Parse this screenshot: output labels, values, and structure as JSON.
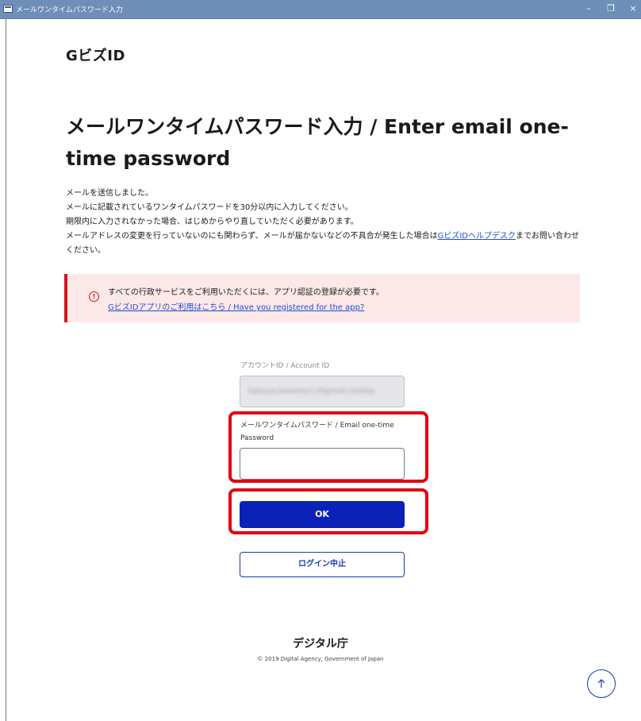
{
  "window": {
    "title": "メールワンタイムパスワード入力",
    "minimize_glyph": "–",
    "restore_glyph": "❐",
    "close_glyph": "×"
  },
  "brand": "GビズID",
  "heading": "メールワンタイムパスワード入力 / Enter email one-time password",
  "intro": {
    "line1": "メールを送信しました。",
    "line2": "メールに記載されているワンタイムパスワードを30分以内に入力してください。",
    "line3": "期限内に入力されなかった場合、はじめからやり直していただく必要があります。",
    "line4_before": "メールアドレスの変更を行っていないのにも関わらず、メールが届かないなどの不具合が発生した場合は",
    "line4_link": "GビズIDヘルプデスク",
    "line4_after": "までお問い合わせください。"
  },
  "alert": {
    "message": "すべての行政サービスをご利用いただくには、アプリ認証の登録が必要です。",
    "link": "GビズIDアプリのご利用はこちら / Have you registered for the app?",
    "icon": "info-circle-icon",
    "color": "#d9101e"
  },
  "form": {
    "account_label": "アカウントID / Account ID",
    "account_value": "katsuya.kanamori.ctf@mail.toshiba",
    "otp_label": "メールワンタイムパスワード / Email one-time Password",
    "otp_value": "",
    "ok_label": "OK",
    "cancel_label": "ログイン中止"
  },
  "footer": {
    "agency": "デジタル庁",
    "copyright": "© 2019 Digital Agency, Government of Japan",
    "to_top_icon": "arrow-up-icon"
  },
  "colors": {
    "primary": "#0b22b8",
    "highlight": "#e5000f",
    "alert_bg": "#fde8e8",
    "link": "#1a4fd6"
  }
}
